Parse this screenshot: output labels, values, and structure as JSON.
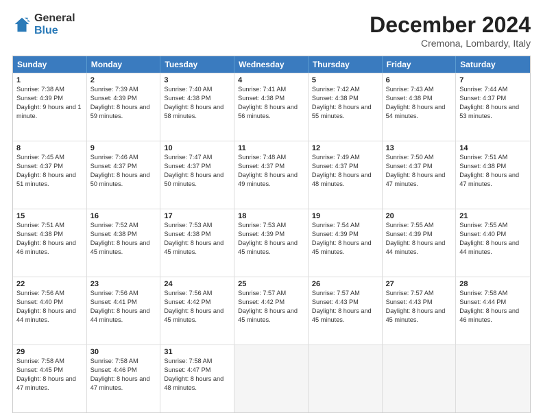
{
  "logo": {
    "general": "General",
    "blue": "Blue"
  },
  "title": "December 2024",
  "subtitle": "Cremona, Lombardy, Italy",
  "days": [
    "Sunday",
    "Monday",
    "Tuesday",
    "Wednesday",
    "Thursday",
    "Friday",
    "Saturday"
  ],
  "weeks": [
    [
      {
        "day": "1",
        "sunrise": "Sunrise: 7:38 AM",
        "sunset": "Sunset: 4:39 PM",
        "daylight": "Daylight: 9 hours and 1 minute."
      },
      {
        "day": "2",
        "sunrise": "Sunrise: 7:39 AM",
        "sunset": "Sunset: 4:39 PM",
        "daylight": "Daylight: 8 hours and 59 minutes."
      },
      {
        "day": "3",
        "sunrise": "Sunrise: 7:40 AM",
        "sunset": "Sunset: 4:38 PM",
        "daylight": "Daylight: 8 hours and 58 minutes."
      },
      {
        "day": "4",
        "sunrise": "Sunrise: 7:41 AM",
        "sunset": "Sunset: 4:38 PM",
        "daylight": "Daylight: 8 hours and 56 minutes."
      },
      {
        "day": "5",
        "sunrise": "Sunrise: 7:42 AM",
        "sunset": "Sunset: 4:38 PM",
        "daylight": "Daylight: 8 hours and 55 minutes."
      },
      {
        "day": "6",
        "sunrise": "Sunrise: 7:43 AM",
        "sunset": "Sunset: 4:38 PM",
        "daylight": "Daylight: 8 hours and 54 minutes."
      },
      {
        "day": "7",
        "sunrise": "Sunrise: 7:44 AM",
        "sunset": "Sunset: 4:37 PM",
        "daylight": "Daylight: 8 hours and 53 minutes."
      }
    ],
    [
      {
        "day": "8",
        "sunrise": "Sunrise: 7:45 AM",
        "sunset": "Sunset: 4:37 PM",
        "daylight": "Daylight: 8 hours and 51 minutes."
      },
      {
        "day": "9",
        "sunrise": "Sunrise: 7:46 AM",
        "sunset": "Sunset: 4:37 PM",
        "daylight": "Daylight: 8 hours and 50 minutes."
      },
      {
        "day": "10",
        "sunrise": "Sunrise: 7:47 AM",
        "sunset": "Sunset: 4:37 PM",
        "daylight": "Daylight: 8 hours and 50 minutes."
      },
      {
        "day": "11",
        "sunrise": "Sunrise: 7:48 AM",
        "sunset": "Sunset: 4:37 PM",
        "daylight": "Daylight: 8 hours and 49 minutes."
      },
      {
        "day": "12",
        "sunrise": "Sunrise: 7:49 AM",
        "sunset": "Sunset: 4:37 PM",
        "daylight": "Daylight: 8 hours and 48 minutes."
      },
      {
        "day": "13",
        "sunrise": "Sunrise: 7:50 AM",
        "sunset": "Sunset: 4:37 PM",
        "daylight": "Daylight: 8 hours and 47 minutes."
      },
      {
        "day": "14",
        "sunrise": "Sunrise: 7:51 AM",
        "sunset": "Sunset: 4:38 PM",
        "daylight": "Daylight: 8 hours and 47 minutes."
      }
    ],
    [
      {
        "day": "15",
        "sunrise": "Sunrise: 7:51 AM",
        "sunset": "Sunset: 4:38 PM",
        "daylight": "Daylight: 8 hours and 46 minutes."
      },
      {
        "day": "16",
        "sunrise": "Sunrise: 7:52 AM",
        "sunset": "Sunset: 4:38 PM",
        "daylight": "Daylight: 8 hours and 45 minutes."
      },
      {
        "day": "17",
        "sunrise": "Sunrise: 7:53 AM",
        "sunset": "Sunset: 4:38 PM",
        "daylight": "Daylight: 8 hours and 45 minutes."
      },
      {
        "day": "18",
        "sunrise": "Sunrise: 7:53 AM",
        "sunset": "Sunset: 4:39 PM",
        "daylight": "Daylight: 8 hours and 45 minutes."
      },
      {
        "day": "19",
        "sunrise": "Sunrise: 7:54 AM",
        "sunset": "Sunset: 4:39 PM",
        "daylight": "Daylight: 8 hours and 45 minutes."
      },
      {
        "day": "20",
        "sunrise": "Sunrise: 7:55 AM",
        "sunset": "Sunset: 4:39 PM",
        "daylight": "Daylight: 8 hours and 44 minutes."
      },
      {
        "day": "21",
        "sunrise": "Sunrise: 7:55 AM",
        "sunset": "Sunset: 4:40 PM",
        "daylight": "Daylight: 8 hours and 44 minutes."
      }
    ],
    [
      {
        "day": "22",
        "sunrise": "Sunrise: 7:56 AM",
        "sunset": "Sunset: 4:40 PM",
        "daylight": "Daylight: 8 hours and 44 minutes."
      },
      {
        "day": "23",
        "sunrise": "Sunrise: 7:56 AM",
        "sunset": "Sunset: 4:41 PM",
        "daylight": "Daylight: 8 hours and 44 minutes."
      },
      {
        "day": "24",
        "sunrise": "Sunrise: 7:56 AM",
        "sunset": "Sunset: 4:42 PM",
        "daylight": "Daylight: 8 hours and 45 minutes."
      },
      {
        "day": "25",
        "sunrise": "Sunrise: 7:57 AM",
        "sunset": "Sunset: 4:42 PM",
        "daylight": "Daylight: 8 hours and 45 minutes."
      },
      {
        "day": "26",
        "sunrise": "Sunrise: 7:57 AM",
        "sunset": "Sunset: 4:43 PM",
        "daylight": "Daylight: 8 hours and 45 minutes."
      },
      {
        "day": "27",
        "sunrise": "Sunrise: 7:57 AM",
        "sunset": "Sunset: 4:43 PM",
        "daylight": "Daylight: 8 hours and 45 minutes."
      },
      {
        "day": "28",
        "sunrise": "Sunrise: 7:58 AM",
        "sunset": "Sunset: 4:44 PM",
        "daylight": "Daylight: 8 hours and 46 minutes."
      }
    ],
    [
      {
        "day": "29",
        "sunrise": "Sunrise: 7:58 AM",
        "sunset": "Sunset: 4:45 PM",
        "daylight": "Daylight: 8 hours and 47 minutes."
      },
      {
        "day": "30",
        "sunrise": "Sunrise: 7:58 AM",
        "sunset": "Sunset: 4:46 PM",
        "daylight": "Daylight: 8 hours and 47 minutes."
      },
      {
        "day": "31",
        "sunrise": "Sunrise: 7:58 AM",
        "sunset": "Sunset: 4:47 PM",
        "daylight": "Daylight: 8 hours and 48 minutes."
      },
      {
        "day": "",
        "sunrise": "",
        "sunset": "",
        "daylight": ""
      },
      {
        "day": "",
        "sunrise": "",
        "sunset": "",
        "daylight": ""
      },
      {
        "day": "",
        "sunrise": "",
        "sunset": "",
        "daylight": ""
      },
      {
        "day": "",
        "sunrise": "",
        "sunset": "",
        "daylight": ""
      }
    ]
  ]
}
